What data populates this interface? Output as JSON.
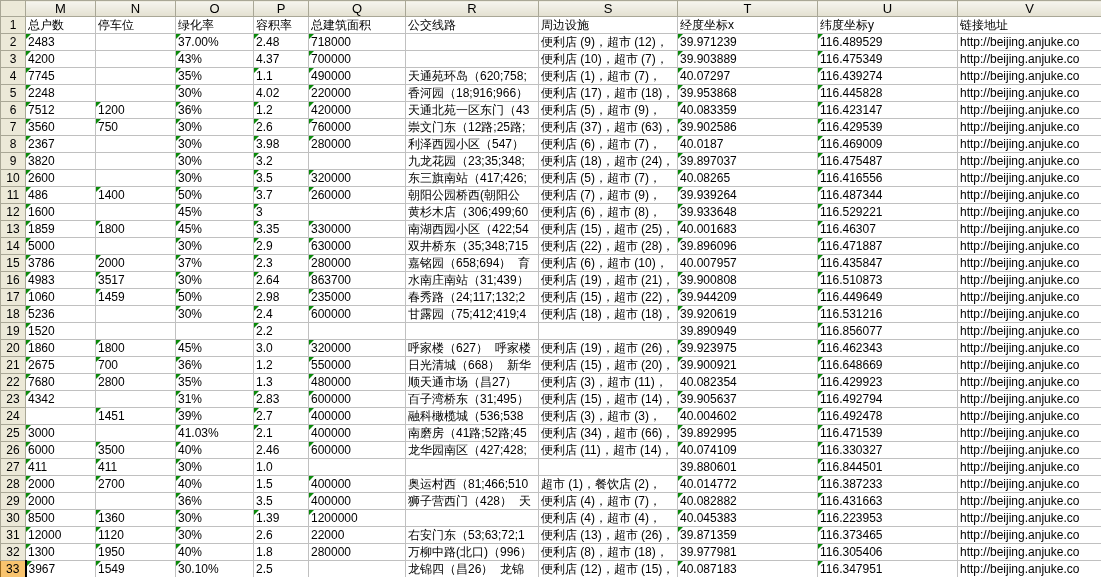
{
  "columns": [
    "M",
    "N",
    "O",
    "P",
    "Q",
    "R",
    "S",
    "T",
    "U",
    "V"
  ],
  "header_row": {
    "row": "1",
    "selected": false,
    "cells": [
      "总户数",
      "停车位",
      "绿化率",
      "容积率",
      "总建筑面积",
      "公交线路",
      "周边设施",
      "经度坐标x",
      "纬度坐标y",
      "链接地址"
    ]
  },
  "rows": [
    {
      "row": "2",
      "selected": false,
      "cells": [
        "2483",
        "",
        "37.00%",
        "2.48",
        "718000",
        "",
        "便利店 (9)，超市 (12)，",
        "39.971239",
        "116.489529",
        "http://beijing.anjuke.co"
      ],
      "flags": [
        true,
        false,
        true,
        true,
        true,
        false,
        false,
        true,
        true,
        false
      ]
    },
    {
      "row": "3",
      "selected": false,
      "cells": [
        "4200",
        "",
        "43%",
        "4.37",
        "700000",
        "",
        "便利店 (10)，超市 (7)，",
        "39.903889",
        "116.475349",
        "http://beijing.anjuke.co"
      ],
      "flags": [
        true,
        false,
        true,
        false,
        true,
        false,
        false,
        true,
        true,
        false
      ]
    },
    {
      "row": "4",
      "selected": false,
      "cells": [
        "7745",
        "",
        "35%",
        "1.1",
        "490000",
        "天通苑环岛（620;758;",
        "便利店 (1)，超市 (7)，",
        "40.07297",
        "116.439274",
        "http://beijing.anjuke.co"
      ],
      "flags": [
        true,
        false,
        true,
        true,
        true,
        false,
        false,
        true,
        true,
        false
      ]
    },
    {
      "row": "5",
      "selected": false,
      "cells": [
        "2248",
        "",
        "30%",
        "4.02",
        "220000",
        "香河园（18;916;966）",
        "便利店 (17)，超市 (18)，",
        "39.953868",
        "116.445828",
        "http://beijing.anjuke.co"
      ],
      "flags": [
        true,
        false,
        true,
        false,
        true,
        false,
        false,
        true,
        true,
        false
      ]
    },
    {
      "row": "6",
      "selected": false,
      "cells": [
        "7512",
        "1200",
        "36%",
        "1.2",
        "420000",
        "天通北苑一区东门（43",
        "便利店 (5)，超市 (9)，",
        "40.083359",
        "116.423147",
        "http://beijing.anjuke.co"
      ],
      "flags": [
        true,
        true,
        true,
        true,
        true,
        false,
        false,
        true,
        true,
        false
      ]
    },
    {
      "row": "7",
      "selected": false,
      "cells": [
        "3560",
        "750",
        "30%",
        "2.6",
        "760000",
        "崇文门东（12路;25路;",
        "便利店 (37)，超市 (63)，",
        "39.902586",
        "116.429539",
        "http://beijing.anjuke.co"
      ],
      "flags": [
        true,
        true,
        true,
        true,
        true,
        false,
        false,
        true,
        true,
        false
      ]
    },
    {
      "row": "8",
      "selected": false,
      "cells": [
        "2367",
        "",
        "30%",
        "3.98",
        "280000",
        "利泽西园小区（547）",
        "便利店 (6)，超市 (7)，",
        "40.0187",
        "116.469009",
        "http://beijing.anjuke.co"
      ],
      "flags": [
        true,
        false,
        true,
        true,
        true,
        false,
        false,
        true,
        true,
        false
      ]
    },
    {
      "row": "9",
      "selected": false,
      "cells": [
        "3820",
        "",
        "30%",
        "3.2",
        "",
        "九龙花园（23;35;348;",
        "便利店 (18)，超市 (24)，",
        "39.897037",
        "116.475487",
        "http://beijing.anjuke.co"
      ],
      "flags": [
        true,
        false,
        true,
        true,
        false,
        false,
        false,
        true,
        true,
        false
      ]
    },
    {
      "row": "10",
      "selected": false,
      "cells": [
        "2600",
        "",
        "30%",
        "3.5",
        "320000",
        "东三旗南站（417;426;",
        "便利店 (5)，超市 (7)，",
        "40.08265",
        "116.416556",
        "http://beijing.anjuke.co"
      ],
      "flags": [
        true,
        false,
        true,
        true,
        true,
        false,
        false,
        true,
        true,
        false
      ]
    },
    {
      "row": "11",
      "selected": false,
      "cells": [
        "486",
        "1400",
        "50%",
        "3.7",
        "260000",
        "朝阳公园桥西(朝阳公",
        "便利店 (7)，超市 (9)，",
        "39.939264",
        "116.487344",
        "http://beijing.anjuke.co"
      ],
      "flags": [
        true,
        true,
        true,
        true,
        true,
        false,
        false,
        true,
        true,
        false
      ]
    },
    {
      "row": "12",
      "selected": false,
      "cells": [
        "1600",
        "",
        "45%",
        "3",
        "",
        "黄杉木店（306;499;60",
        "便利店 (6)，超市 (8)，",
        "39.933648",
        "116.529221",
        "http://beijing.anjuke.co"
      ],
      "flags": [
        true,
        false,
        true,
        true,
        false,
        false,
        false,
        true,
        true,
        false
      ]
    },
    {
      "row": "13",
      "selected": false,
      "cells": [
        "1859",
        "1800",
        "45%",
        "3.35",
        "330000",
        "南湖西园小区（422;54",
        "便利店 (15)，超市 (25)，",
        "40.001683",
        "116.46307",
        "http://beijing.anjuke.co"
      ],
      "flags": [
        true,
        true,
        true,
        true,
        true,
        false,
        false,
        true,
        true,
        false
      ]
    },
    {
      "row": "14",
      "selected": false,
      "cells": [
        "5000",
        "",
        "30%",
        "2.9",
        "630000",
        "双井桥东（35;348;715",
        "便利店 (22)，超市 (28)，",
        "39.896096",
        "116.471887",
        "http://beijing.anjuke.co"
      ],
      "flags": [
        true,
        false,
        true,
        true,
        true,
        false,
        false,
        true,
        true,
        false
      ]
    },
    {
      "row": "15",
      "selected": false,
      "cells": [
        "3786",
        "2000",
        "37%",
        "2.3",
        "280000",
        "嘉铭园（658;694）  育",
        "便利店 (6)，超市 (10)，",
        "40.007957",
        "116.435847",
        "http://beijing.anjuke.co"
      ],
      "flags": [
        true,
        true,
        true,
        true,
        true,
        false,
        false,
        false,
        true,
        false
      ]
    },
    {
      "row": "16",
      "selected": false,
      "cells": [
        "4983",
        "3517",
        "30%",
        "2.64",
        "863700",
        "水南庄南站（31;439）",
        "便利店 (19)，超市 (21)，",
        "39.900808",
        "116.510873",
        "http://beijing.anjuke.co"
      ],
      "flags": [
        true,
        true,
        true,
        true,
        true,
        false,
        false,
        true,
        true,
        false
      ]
    },
    {
      "row": "17",
      "selected": false,
      "cells": [
        "1060",
        "1459",
        "50%",
        "2.98",
        "235000",
        "春秀路（24;117;132;2",
        "便利店 (15)，超市 (22)，",
        "39.944209",
        "116.449649",
        "http://beijing.anjuke.co"
      ],
      "flags": [
        true,
        true,
        true,
        false,
        true,
        false,
        false,
        true,
        true,
        false
      ]
    },
    {
      "row": "18",
      "selected": false,
      "cells": [
        "5236",
        "",
        "30%",
        "2.4",
        "600000",
        "甘露园（75;412;419;4",
        "便利店 (18)，超市 (18)，",
        "39.920619",
        "116.531216",
        "http://beijing.anjuke.co"
      ],
      "flags": [
        true,
        false,
        true,
        true,
        true,
        false,
        false,
        true,
        true,
        false
      ]
    },
    {
      "row": "19",
      "selected": false,
      "cells": [
        "1520",
        "",
        "",
        "2.2",
        "",
        "",
        "",
        "39.890949",
        "116.856077",
        "http://beijing.anjuke.co"
      ],
      "flags": [
        true,
        false,
        false,
        true,
        false,
        false,
        false,
        false,
        true,
        false
      ]
    },
    {
      "row": "20",
      "selected": false,
      "cells": [
        "1860",
        "1800",
        "45%",
        "3.0",
        "320000",
        "呼家楼（627）  呼家楼",
        "便利店 (19)，超市 (26)，",
        "39.923975",
        "116.462343",
        "http://beijing.anjuke.co"
      ],
      "flags": [
        true,
        true,
        true,
        false,
        true,
        false,
        false,
        true,
        true,
        false
      ]
    },
    {
      "row": "21",
      "selected": false,
      "cells": [
        "2675",
        "700",
        "36%",
        "1.2",
        "550000",
        "日光清城（668）  新华",
        "便利店 (15)，超市 (20)，",
        "39.900921",
        "116.648669",
        "http://beijing.anjuke.co"
      ],
      "flags": [
        true,
        true,
        true,
        false,
        true,
        false,
        false,
        true,
        true,
        false
      ]
    },
    {
      "row": "22",
      "selected": false,
      "cells": [
        "7680",
        "2800",
        "35%",
        "1.3",
        "480000",
        "顺天通市场（昌27）",
        "便利店 (3)，超市 (11)，",
        "40.082354",
        "116.429923",
        "http://beijing.anjuke.co"
      ],
      "flags": [
        true,
        true,
        true,
        false,
        true,
        false,
        false,
        false,
        true,
        false
      ]
    },
    {
      "row": "23",
      "selected": false,
      "cells": [
        "4342",
        "",
        "31%",
        "2.83",
        "600000",
        "百子湾桥东（31;495）",
        "便利店 (15)，超市 (14)，",
        "39.905637",
        "116.492794",
        "http://beijing.anjuke.co"
      ],
      "flags": [
        true,
        false,
        true,
        true,
        true,
        false,
        false,
        true,
        true,
        false
      ]
    },
    {
      "row": "24",
      "selected": false,
      "cells": [
        "",
        "1451",
        "39%",
        "2.7",
        "400000",
        "融科橄榄城（536;538",
        "便利店 (3)，超市 (3)，",
        "40.004602",
        "116.492478",
        "http://beijing.anjuke.co"
      ],
      "flags": [
        false,
        true,
        true,
        true,
        true,
        false,
        false,
        true,
        true,
        false
      ]
    },
    {
      "row": "25",
      "selected": false,
      "cells": [
        "3000",
        "",
        "41.03%",
        "2.1",
        "400000",
        "南磨房（41路;52路;45",
        "便利店 (34)，超市 (66)，",
        "39.892995",
        "116.471539",
        "http://beijing.anjuke.co"
      ],
      "flags": [
        true,
        false,
        true,
        true,
        true,
        false,
        false,
        true,
        true,
        false
      ]
    },
    {
      "row": "26",
      "selected": false,
      "cells": [
        "6000",
        "3500",
        "40%",
        "2.46",
        "600000",
        "龙华园南区（427;428;",
        "便利店 (11)，超市 (14)，",
        "40.074109",
        "116.330327",
        "http://beijing.anjuke.co"
      ],
      "flags": [
        true,
        true,
        true,
        false,
        true,
        false,
        false,
        true,
        true,
        false
      ]
    },
    {
      "row": "27",
      "selected": false,
      "cells": [
        "411",
        "411",
        "30%",
        "1.0",
        "",
        "",
        "",
        "39.880601",
        "116.844501",
        "http://beijing.anjuke.co"
      ],
      "flags": [
        true,
        true,
        true,
        false,
        false,
        false,
        false,
        false,
        true,
        false
      ]
    },
    {
      "row": "28",
      "selected": false,
      "cells": [
        "2000",
        "2700",
        "40%",
        "1.5",
        "400000",
        "奥运村西（81;466;510",
        "超市 (1)，餐饮店 (2)，",
        "40.014772",
        "116.387233",
        "http://beijing.anjuke.co"
      ],
      "flags": [
        true,
        true,
        true,
        false,
        true,
        false,
        false,
        true,
        true,
        false
      ]
    },
    {
      "row": "29",
      "selected": false,
      "cells": [
        "2000",
        "",
        "36%",
        "3.5",
        "400000",
        "狮子营西门（428）  天",
        "便利店 (4)，超市 (7)，",
        "40.082882",
        "116.431663",
        "http://beijing.anjuke.co"
      ],
      "flags": [
        true,
        false,
        true,
        false,
        true,
        false,
        false,
        true,
        true,
        false
      ]
    },
    {
      "row": "30",
      "selected": false,
      "cells": [
        "8500",
        "1360",
        "30%",
        "1.39",
        "1200000",
        "",
        "便利店 (4)，超市 (4)，",
        "40.045383",
        "116.223953",
        "http://beijing.anjuke.co"
      ],
      "flags": [
        true,
        true,
        true,
        true,
        true,
        false,
        false,
        true,
        true,
        false
      ]
    },
    {
      "row": "31",
      "selected": false,
      "cells": [
        "12000",
        "1120",
        "30%",
        "2.6",
        "22000",
        "右安门东（53;63;72;1",
        "便利店 (13)，超市 (26)，",
        "39.871359",
        "116.373465",
        "http://beijing.anjuke.co"
      ],
      "flags": [
        true,
        true,
        true,
        false,
        false,
        false,
        false,
        true,
        true,
        false
      ]
    },
    {
      "row": "32",
      "selected": false,
      "cells": [
        "1300",
        "1950",
        "40%",
        "1.8",
        "280000",
        "万柳中路(北口)（996）",
        "便利店 (8)，超市 (18)，",
        "39.977981",
        "116.305406",
        "http://beijing.anjuke.co"
      ],
      "flags": [
        true,
        true,
        true,
        false,
        false,
        false,
        false,
        false,
        true,
        false
      ]
    },
    {
      "row": "33",
      "selected": true,
      "cells": [
        "3967",
        "1549",
        "30.10%",
        "2.5",
        "",
        "龙锦四（昌26）  龙锦",
        "便利店 (12)，超市 (15)，",
        "40.087183",
        "116.347951",
        "http://beijing.anjuke.co"
      ],
      "flags": [
        true,
        true,
        true,
        false,
        false,
        false,
        false,
        true,
        true,
        false
      ]
    }
  ]
}
